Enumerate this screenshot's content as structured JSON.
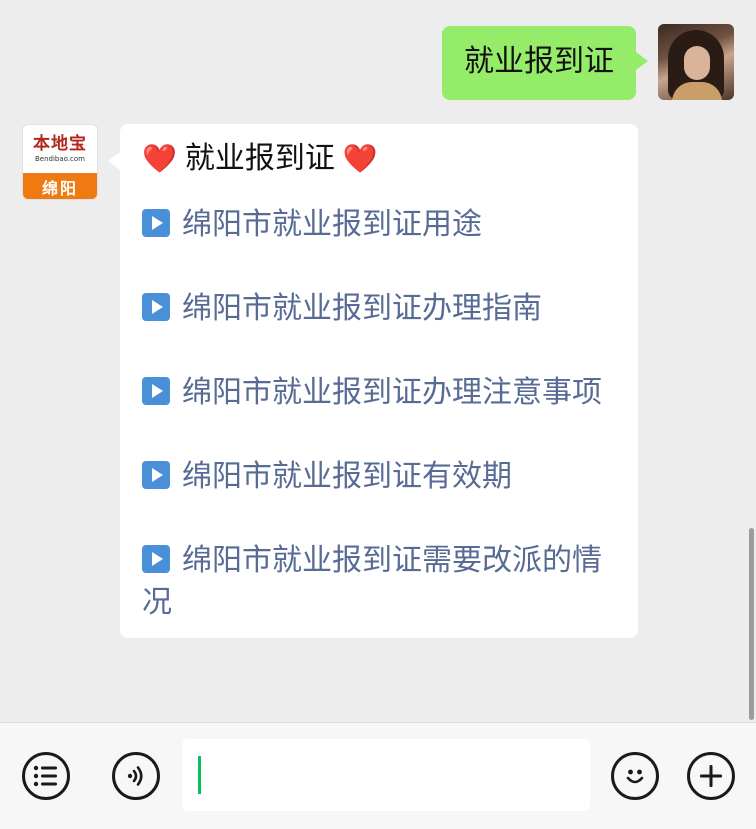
{
  "outgoing": {
    "text": "就业报到证"
  },
  "bot": {
    "logo_name": "本地宝",
    "logo_domain": "Bendibao.com",
    "logo_city": "绵阳"
  },
  "incoming": {
    "heart_left": "❤️",
    "title": "就业报到证",
    "heart_right": "❤️",
    "links": [
      "绵阳市就业报到证用途",
      "绵阳市就业报到证办理指南",
      "绵阳市就业报到证办理注意事项",
      "绵阳市就业报到证有效期",
      "绵阳市就业报到证需要改派的情况"
    ]
  },
  "colors": {
    "outgoing_bubble": "#95ec69",
    "link_text": "#576b95",
    "caret": "#07c160"
  },
  "icons": [
    "menu-list-icon",
    "voice-icon",
    "emoji-icon",
    "plus-icon",
    "play-icon",
    "heart-icon"
  ]
}
